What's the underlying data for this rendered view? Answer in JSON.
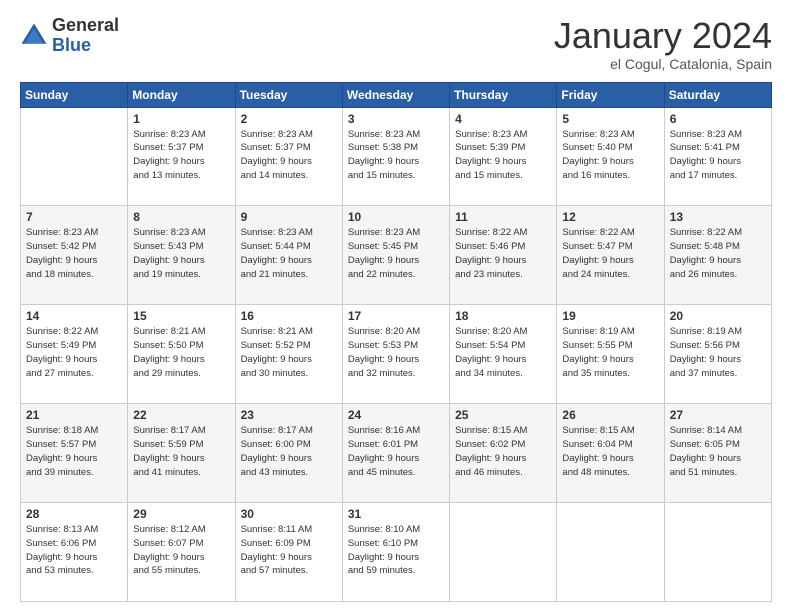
{
  "logo": {
    "line1": "General",
    "line2": "Blue"
  },
  "header": {
    "month": "January 2024",
    "location": "el Cogul, Catalonia, Spain"
  },
  "weekdays": [
    "Sunday",
    "Monday",
    "Tuesday",
    "Wednesday",
    "Thursday",
    "Friday",
    "Saturday"
  ],
  "weeks": [
    [
      {
        "day": "",
        "info": ""
      },
      {
        "day": "1",
        "info": "Sunrise: 8:23 AM\nSunset: 5:37 PM\nDaylight: 9 hours\nand 13 minutes."
      },
      {
        "day": "2",
        "info": "Sunrise: 8:23 AM\nSunset: 5:37 PM\nDaylight: 9 hours\nand 14 minutes."
      },
      {
        "day": "3",
        "info": "Sunrise: 8:23 AM\nSunset: 5:38 PM\nDaylight: 9 hours\nand 15 minutes."
      },
      {
        "day": "4",
        "info": "Sunrise: 8:23 AM\nSunset: 5:39 PM\nDaylight: 9 hours\nand 15 minutes."
      },
      {
        "day": "5",
        "info": "Sunrise: 8:23 AM\nSunset: 5:40 PM\nDaylight: 9 hours\nand 16 minutes."
      },
      {
        "day": "6",
        "info": "Sunrise: 8:23 AM\nSunset: 5:41 PM\nDaylight: 9 hours\nand 17 minutes."
      }
    ],
    [
      {
        "day": "7",
        "info": "Sunrise: 8:23 AM\nSunset: 5:42 PM\nDaylight: 9 hours\nand 18 minutes."
      },
      {
        "day": "8",
        "info": "Sunrise: 8:23 AM\nSunset: 5:43 PM\nDaylight: 9 hours\nand 19 minutes."
      },
      {
        "day": "9",
        "info": "Sunrise: 8:23 AM\nSunset: 5:44 PM\nDaylight: 9 hours\nand 21 minutes."
      },
      {
        "day": "10",
        "info": "Sunrise: 8:23 AM\nSunset: 5:45 PM\nDaylight: 9 hours\nand 22 minutes."
      },
      {
        "day": "11",
        "info": "Sunrise: 8:22 AM\nSunset: 5:46 PM\nDaylight: 9 hours\nand 23 minutes."
      },
      {
        "day": "12",
        "info": "Sunrise: 8:22 AM\nSunset: 5:47 PM\nDaylight: 9 hours\nand 24 minutes."
      },
      {
        "day": "13",
        "info": "Sunrise: 8:22 AM\nSunset: 5:48 PM\nDaylight: 9 hours\nand 26 minutes."
      }
    ],
    [
      {
        "day": "14",
        "info": "Sunrise: 8:22 AM\nSunset: 5:49 PM\nDaylight: 9 hours\nand 27 minutes."
      },
      {
        "day": "15",
        "info": "Sunrise: 8:21 AM\nSunset: 5:50 PM\nDaylight: 9 hours\nand 29 minutes."
      },
      {
        "day": "16",
        "info": "Sunrise: 8:21 AM\nSunset: 5:52 PM\nDaylight: 9 hours\nand 30 minutes."
      },
      {
        "day": "17",
        "info": "Sunrise: 8:20 AM\nSunset: 5:53 PM\nDaylight: 9 hours\nand 32 minutes."
      },
      {
        "day": "18",
        "info": "Sunrise: 8:20 AM\nSunset: 5:54 PM\nDaylight: 9 hours\nand 34 minutes."
      },
      {
        "day": "19",
        "info": "Sunrise: 8:19 AM\nSunset: 5:55 PM\nDaylight: 9 hours\nand 35 minutes."
      },
      {
        "day": "20",
        "info": "Sunrise: 8:19 AM\nSunset: 5:56 PM\nDaylight: 9 hours\nand 37 minutes."
      }
    ],
    [
      {
        "day": "21",
        "info": "Sunrise: 8:18 AM\nSunset: 5:57 PM\nDaylight: 9 hours\nand 39 minutes."
      },
      {
        "day": "22",
        "info": "Sunrise: 8:17 AM\nSunset: 5:59 PM\nDaylight: 9 hours\nand 41 minutes."
      },
      {
        "day": "23",
        "info": "Sunrise: 8:17 AM\nSunset: 6:00 PM\nDaylight: 9 hours\nand 43 minutes."
      },
      {
        "day": "24",
        "info": "Sunrise: 8:16 AM\nSunset: 6:01 PM\nDaylight: 9 hours\nand 45 minutes."
      },
      {
        "day": "25",
        "info": "Sunrise: 8:15 AM\nSunset: 6:02 PM\nDaylight: 9 hours\nand 46 minutes."
      },
      {
        "day": "26",
        "info": "Sunrise: 8:15 AM\nSunset: 6:04 PM\nDaylight: 9 hours\nand 48 minutes."
      },
      {
        "day": "27",
        "info": "Sunrise: 8:14 AM\nSunset: 6:05 PM\nDaylight: 9 hours\nand 51 minutes."
      }
    ],
    [
      {
        "day": "28",
        "info": "Sunrise: 8:13 AM\nSunset: 6:06 PM\nDaylight: 9 hours\nand 53 minutes."
      },
      {
        "day": "29",
        "info": "Sunrise: 8:12 AM\nSunset: 6:07 PM\nDaylight: 9 hours\nand 55 minutes."
      },
      {
        "day": "30",
        "info": "Sunrise: 8:11 AM\nSunset: 6:09 PM\nDaylight: 9 hours\nand 57 minutes."
      },
      {
        "day": "31",
        "info": "Sunrise: 8:10 AM\nSunset: 6:10 PM\nDaylight: 9 hours\nand 59 minutes."
      },
      {
        "day": "",
        "info": ""
      },
      {
        "day": "",
        "info": ""
      },
      {
        "day": "",
        "info": ""
      }
    ]
  ]
}
